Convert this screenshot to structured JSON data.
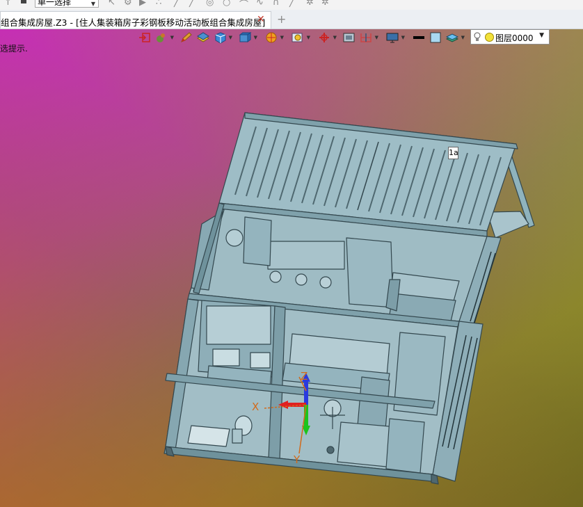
{
  "toolbar_top": {
    "select_mode": "单一选择"
  },
  "tabs": {
    "document_title": "组合集成房屋.Z3 - [住人集装箱房子彩钢板移动活动板组合集成房屋]",
    "close_symbol": "✕",
    "new_tab_symbol": "+"
  },
  "viewport": {
    "hint": "选提示.",
    "layer": {
      "name": "图层0000"
    },
    "dimension_tag": "1a",
    "axes": {
      "x_label": "X",
      "y_label": "Y",
      "z_label": "Z"
    },
    "toolbar_icons": [
      "exit-sketch-icon",
      "shape-tool-icon",
      "pencil-icon",
      "layer-stack-icon",
      "cube-icon",
      "shaded-cube-icon",
      "render-sphere-icon",
      "view-magnify-icon",
      "axis-pin-icon",
      "frame-icon",
      "bracket-icon",
      "monitor-icon",
      "line-color-icon",
      "fill-color-icon",
      "layers-icon"
    ],
    "colors": {
      "model_fill": "#8fb3bd",
      "model_edge": "#33474e",
      "axis_x": "#e02020",
      "axis_y": "#1cc41c",
      "axis_z": "#2a3adf",
      "label_orange": "#d26a1a"
    }
  }
}
